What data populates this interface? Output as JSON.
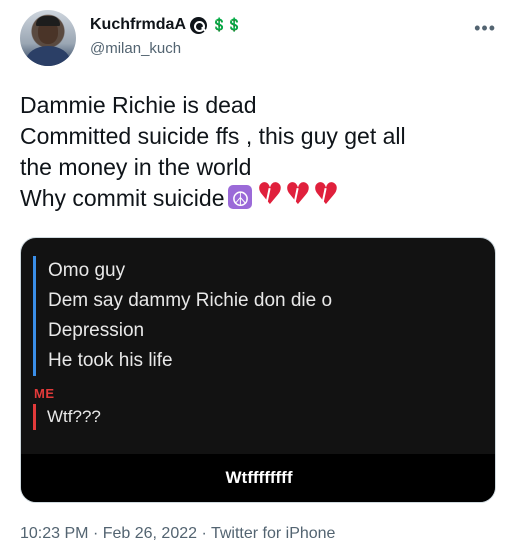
{
  "author": {
    "display_name": "KuchfrmdaA",
    "name_emojis": "💲💲",
    "handle": "@milan_kuch"
  },
  "tweet": {
    "lines": [
      "Dammie Richie is dead",
      "Committed suicide ffs , this guy get all",
      "the money in the world",
      "Why commit suicide"
    ],
    "trailing_emojis": [
      "peace-symbol",
      "broken-heart",
      "broken-heart",
      "broken-heart"
    ]
  },
  "media": {
    "chat_lines": [
      "Omo guy",
      "Dem say dammy Richie don die o",
      "Depression",
      "He took his life"
    ],
    "me_label": "ME",
    "me_message": "Wtf???",
    "caption": "Wtffffffff"
  },
  "meta": {
    "time": "10:23 PM",
    "separator": "·",
    "date": "Feb 26, 2022",
    "source": "Twitter for iPhone"
  },
  "colors": {
    "text": "#0f1419",
    "secondary": "#536471",
    "chat_bar_blue": "#3a8ee8",
    "me_red": "#e23a3a",
    "heart_red": "#e0203c",
    "peace_purple": "#9b6ad8"
  }
}
